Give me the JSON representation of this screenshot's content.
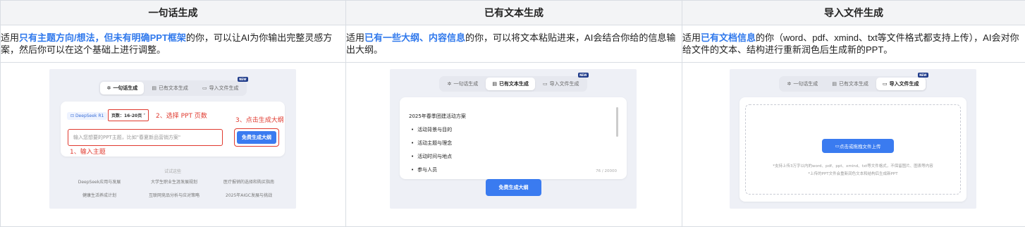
{
  "columns": [
    {
      "header": "一句话生成",
      "desc_pre": "适用",
      "desc_hl": "只有主题方向/想法，但未有明确PPT框架",
      "desc_post": "的你，可以让AI为你输出完整灵感方案，然后你可以在这个基础上进行调整。"
    },
    {
      "header": "已有文本生成",
      "desc_pre": "适用",
      "desc_hl": "已有一些大纲、内容信息",
      "desc_post": "的你，可以将文本粘贴进来，AI会结合你给的信息输出大纲。"
    },
    {
      "header": "导入文件生成",
      "desc_pre": "适用",
      "desc_hl": "已有文档信息",
      "desc_post": "的你（word、pdf、xmind、txt等文件格式都支持上传），AI会对你给文件的文本、结构进行重新润色后生成新的PPT。"
    }
  ],
  "tabs": {
    "one_sentence": "一句话生成",
    "existing_text": "已有文本生成",
    "import_file": "导入文件生成",
    "new_badge": "NEW"
  },
  "shot1": {
    "model": "DeepSeek R1",
    "pages": "页数：16-20页 ˅",
    "annot_pages": "2、选择 PPT 页数",
    "annot_generate": "3、点击生成大纲",
    "annot_input": "1、输入主题",
    "placeholder": "输入您想要的PPT主题，比如\"春夏新品营销方案\"",
    "generate_button": "免费生成大纲",
    "try_title": "试试这些",
    "suggestions": [
      "DeepSeek应用与发展",
      "大学生职业生涯发展规划",
      "医疗报销的选择和购买指南",
      "健康生活养成计划",
      "互联网竞品分析与应对策略",
      "2025年AIGC发展与挑战"
    ]
  },
  "shot2": {
    "doc_title": "2025年春季团建活动方案",
    "bullets": [
      "活动背景与目的",
      "活动主题与理念",
      "活动时间与地点",
      "参与人员"
    ],
    "counter": "76 / 20000",
    "generate_button": "免费生成大纲"
  },
  "shot3": {
    "upload_button": "点击或拖拽文件上传",
    "hint_line1": "*支持上传3万字以内的word、pdf、ppt、xmind、txt等文件格式，不保留图片、图表等内容",
    "hint_line2": "*上传的PPT文件会重新润色文本和结构后生成新PPT"
  }
}
